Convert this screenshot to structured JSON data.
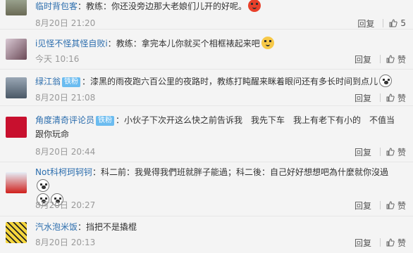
{
  "comments": [
    {
      "user": "临时背包客",
      "colon": "：",
      "text": "教练：你还没旁边那大老娘们儿开的好呢。",
      "time": "8月20日 21:20",
      "reply": "回复",
      "likes": "5"
    },
    {
      "user": "i见怪不怪其怪自败i",
      "colon": "：",
      "text": "教练：拿完本儿你就买个相框裱起来吧",
      "time": "今天 10:16",
      "reply": "回复",
      "likes": "赞"
    },
    {
      "user": "绿江翁",
      "badge": "铁粉",
      "colon": "：",
      "text": "漆黑的雨夜跑六百公里的夜路时，教练打盹醒来眯着眼问还有多长时间到点儿",
      "time": "8月20日 21:08",
      "reply": "回复",
      "likes": "赞"
    },
    {
      "user": "角度清奇评论员",
      "badge": "铁粉",
      "colon": "：",
      "text": "小伙子下次开这么快之前告诉我　我先下车　我上有老下有小的　不值当跟你玩命",
      "time": "8月20日 20:44",
      "reply": "回复",
      "likes": "赞"
    },
    {
      "user": "Not科柯珂轲钶",
      "colon": "：",
      "text": "科二前：我覺得我們班就胖子能過；科二後：自己好好想想吧為什麼就你沒過",
      "time": "8月20日 20:27",
      "reply": "回复",
      "likes": "赞"
    },
    {
      "user": "汽水泡米饭",
      "colon": "：",
      "text": "挡把不是撬棍",
      "time": "8月20日 20:13",
      "reply": "回复",
      "likes": "赞"
    }
  ],
  "colors": {
    "username_orange": "#eb7350",
    "username_blue": "#2b6dad",
    "badge_blue": "#6bbcf0"
  }
}
